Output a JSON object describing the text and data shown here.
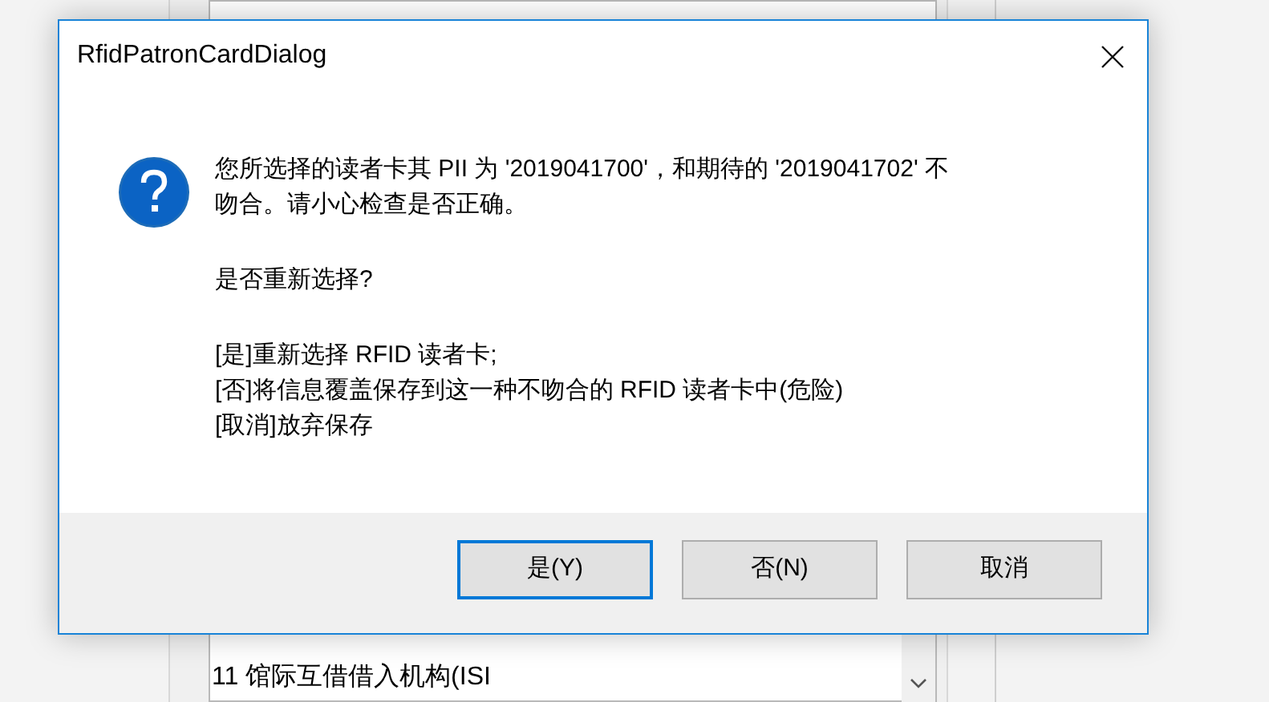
{
  "background_list": {
    "items": [
      "11 馆际互借借入机构(ISI"
    ]
  },
  "dialog": {
    "title": "RfidPatronCardDialog",
    "message": [
      "您所选择的读者卡其 PII 为 '2019041700'，和期待的 '2019041702' 不吻合。请小心检查是否正确。",
      "是否重新选择?",
      "[是]重新选择 RFID 读者卡;\n[否]将信息覆盖保存到这一种不吻合的 RFID 读者卡中(危险)\n[取消]放弃保存"
    ],
    "buttons": [
      {
        "label": "是(Y)",
        "selected": true
      },
      {
        "label": "否(N)",
        "selected": false
      },
      {
        "label": "取消",
        "selected": false
      }
    ]
  }
}
